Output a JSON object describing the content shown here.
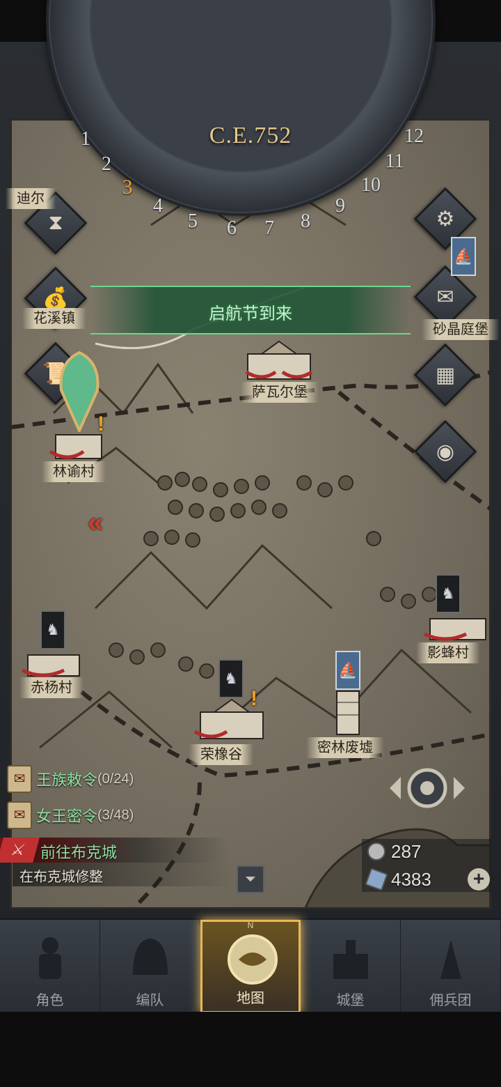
{
  "calendar": {
    "year": "C.E.752",
    "months": [
      "1",
      "2",
      "3",
      "4",
      "5",
      "6",
      "7",
      "8",
      "9",
      "10",
      "11",
      "12"
    ],
    "current_month": "3"
  },
  "event_banner": "启航节到来",
  "places": {
    "top_left": "迪尔",
    "huabian": "花溪镇",
    "shajing": "砂晶庭堡",
    "sawaer": "萨瓦尔堡",
    "linyu": "林谕村",
    "yingfeng": "影蜂村",
    "chiyang": "赤杨村",
    "rongxiang": "荣橡谷",
    "milin": "密林废墟"
  },
  "side_buttons": {
    "left": [
      "hourglass-icon",
      "money-bag-icon",
      "scroll-icon"
    ],
    "right": [
      "gear-icon",
      "mail-icon",
      "grid-icon",
      "coin-icon"
    ]
  },
  "quests": [
    {
      "title": "王族敕令",
      "count": "(0/24)"
    },
    {
      "title": "女王密令",
      "count": "(3/48)"
    }
  ],
  "travel": {
    "title": "前往布克城",
    "status": "在布克城修整"
  },
  "resources": {
    "silver": "287",
    "crystal": "4383"
  },
  "nav": {
    "compass_n": "N",
    "items": [
      {
        "label": "角色",
        "icon": "knight-icon",
        "active": false
      },
      {
        "label": "编队",
        "icon": "helmet-icon",
        "active": false
      },
      {
        "label": "地图",
        "icon": "map-icon",
        "active": true
      },
      {
        "label": "城堡",
        "icon": "castle-icon",
        "active": false
      },
      {
        "label": "佣兵团",
        "icon": "mercenary-icon",
        "active": false
      }
    ]
  }
}
